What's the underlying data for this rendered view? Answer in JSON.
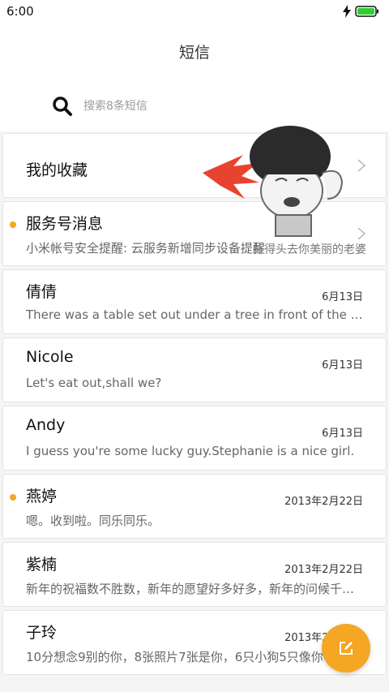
{
  "status_bar": {
    "time": "6:00"
  },
  "header": {
    "title": "短信"
  },
  "search": {
    "placeholder": "搜索8条短信"
  },
  "favorites": {
    "label": "我的收藏"
  },
  "service": {
    "name": "服务号消息",
    "preview": "小米帐号安全提醒: 云服务新增同步设备提醒",
    "unread": true
  },
  "messages": [
    {
      "name": "倩倩",
      "date": "6月13日",
      "preview": "There was a table set out under a tree in front of the house"
    },
    {
      "name": "Nicole",
      "date": "6月13日",
      "preview": "Let's eat out,shall we?"
    },
    {
      "name": "Andy",
      "date": "6月13日",
      "preview": "I guess you're some lucky guy.Stephanie is a nice girl."
    },
    {
      "name": "燕婷",
      "date": "2013年2月22日",
      "preview": "嗯。收到啦。同乐同乐。",
      "unread": true
    },
    {
      "name": "紫楠",
      "date": "2013年2月22日",
      "preview": "新年的祝福数不胜数，新年的愿望好多好多，新年的问候千言万语"
    },
    {
      "name": "子玲",
      "date": "2013年2月22日",
      "preview": "10分想念9别的你，8张照片7张是你，6只小狗5只像你"
    }
  ],
  "sticker": {
    "caption": "扑得头去你美丽的老婆"
  },
  "colors": {
    "accent": "#f5a623",
    "battery": "#2fcf2f"
  },
  "icons": {
    "compose": "compose-icon",
    "search": "search-icon"
  }
}
